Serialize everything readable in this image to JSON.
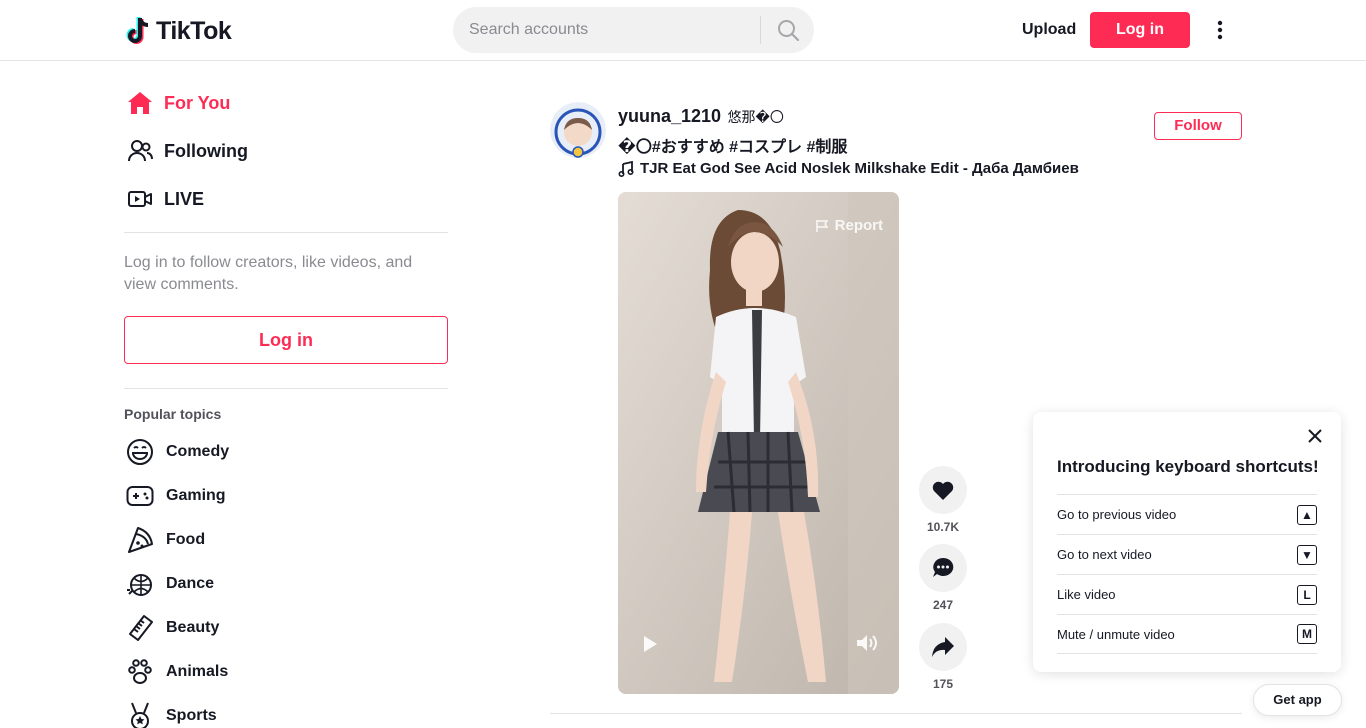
{
  "header": {
    "logo_text": "TikTok",
    "search_placeholder": "Search accounts",
    "upload_label": "Upload",
    "login_label": "Log in"
  },
  "sidebar": {
    "nav": [
      {
        "label": "For You",
        "icon": "home-icon",
        "active": true
      },
      {
        "label": "Following",
        "icon": "people-icon",
        "active": false
      },
      {
        "label": "LIVE",
        "icon": "live-icon",
        "active": false
      }
    ],
    "login_hint": "Log in to follow creators, like videos, and view comments.",
    "login_button": "Log in",
    "topics_title": "Popular topics",
    "topics": [
      {
        "label": "Comedy",
        "icon": "comedy-icon"
      },
      {
        "label": "Gaming",
        "icon": "gaming-icon"
      },
      {
        "label": "Food",
        "icon": "food-icon"
      },
      {
        "label": "Dance",
        "icon": "dance-icon"
      },
      {
        "label": "Beauty",
        "icon": "beauty-icon"
      },
      {
        "label": "Animals",
        "icon": "animals-icon"
      },
      {
        "label": "Sports",
        "icon": "sports-icon"
      }
    ]
  },
  "post": {
    "author_id": "yuuna_1210",
    "author_nickname": "悠那�〇",
    "caption": "�〇#おすすめ #コスプレ #制服",
    "music": "TJR Eat God See Acid Noslek Milkshake Edit - Даба Дамбиев",
    "follow_label": "Follow",
    "report_label": "Report",
    "likes": "10.7K",
    "comments": "247",
    "shares": "175"
  },
  "shortcuts": {
    "title": "Introducing keyboard shortcuts!",
    "items": [
      {
        "label": "Go to previous video",
        "key": "▲"
      },
      {
        "label": "Go to next video",
        "key": "▼"
      },
      {
        "label": "Like video",
        "key": "L"
      },
      {
        "label": "Mute / unmute video",
        "key": "M"
      }
    ]
  },
  "get_app_label": "Get app",
  "colors": {
    "accent": "#fe2c55",
    "text": "#161823",
    "muted": "#8a8b91"
  }
}
